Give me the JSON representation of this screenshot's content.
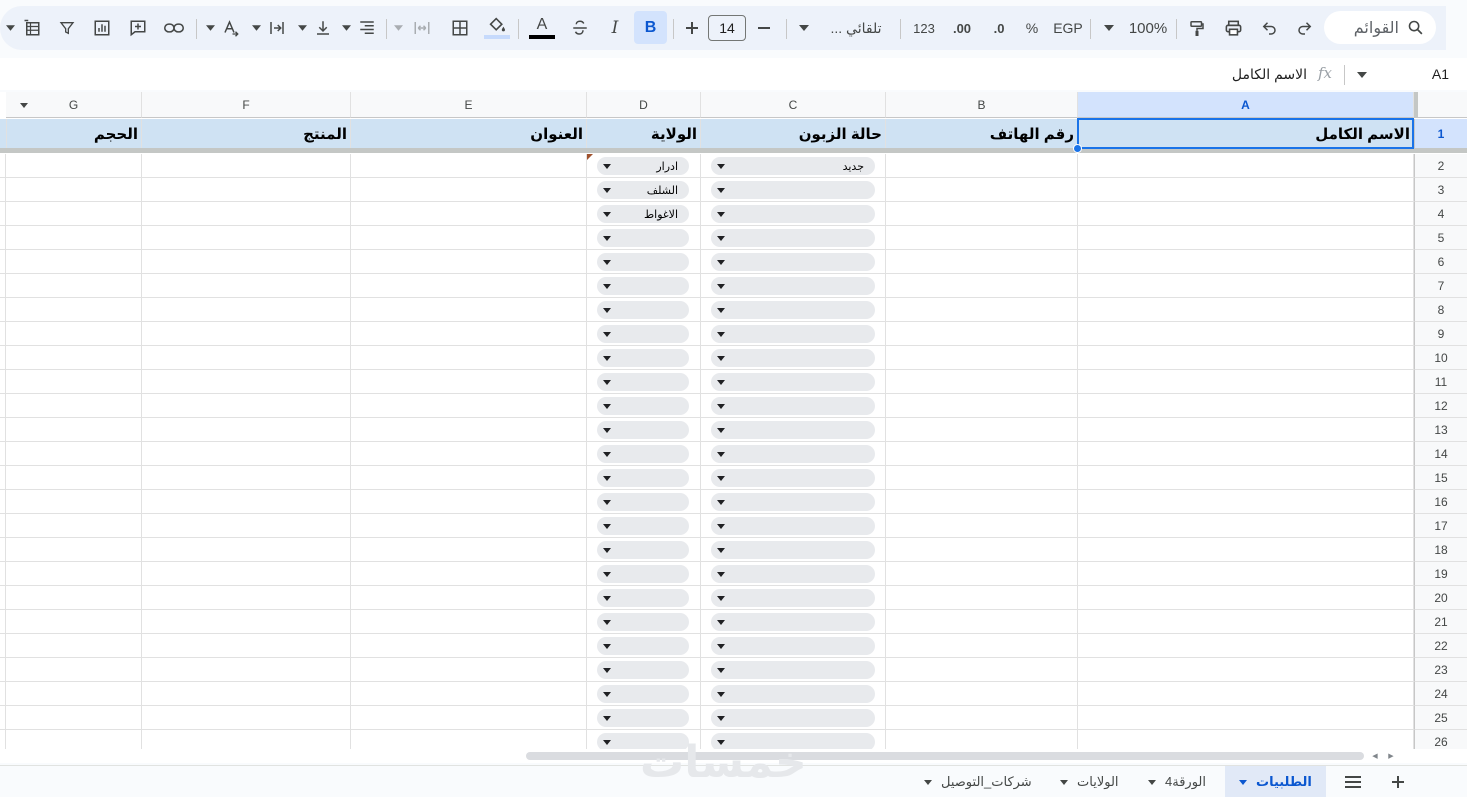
{
  "toolbar": {
    "search_label": "القوائم",
    "zoom": "100%",
    "currency": "EGP",
    "percent": "%",
    "decimal_decrease": ".0",
    "decimal_increase": ".00",
    "number_format": "123",
    "font_name": "تلقائي ...",
    "font_size": "14",
    "bold": "B",
    "italic": "I",
    "text_color_glyph": "A",
    "text_color": "#000000",
    "accent": "#0b57d0"
  },
  "formula_bar": {
    "cell_ref": "A1",
    "fx": "fx",
    "value": "الاسم الكامل"
  },
  "columns": [
    "A",
    "B",
    "C",
    "D",
    "E",
    "F",
    "G"
  ],
  "header_row": {
    "A": "الاسم الكامل",
    "B": "رقم الهاتف",
    "C": "حالة الزبون",
    "D": "الولاية",
    "E": "العنوان",
    "F": "المنتج",
    "G": "الحجم"
  },
  "row_numbers": [
    "1",
    "2",
    "3",
    "4",
    "5",
    "6",
    "7",
    "8",
    "9",
    "10",
    "11",
    "12",
    "13",
    "14",
    "15",
    "16",
    "17",
    "18",
    "19",
    "20",
    "21",
    "22",
    "23",
    "24",
    "25",
    "26"
  ],
  "dropdowns": {
    "C": [
      "جديد",
      "",
      "",
      "",
      "",
      "",
      "",
      "",
      "",
      "",
      "",
      "",
      "",
      "",
      "",
      "",
      "",
      "",
      "",
      "",
      "",
      "",
      "",
      "",
      ""
    ],
    "D": [
      "ادرار",
      "الشلف",
      "الاغواط",
      "",
      "",
      "",
      "",
      "",
      "",
      "",
      "",
      "",
      "",
      "",
      "",
      "",
      "",
      "",
      "",
      "",
      "",
      "",
      "",
      "",
      ""
    ]
  },
  "sheet_tabs": [
    {
      "label": "الطلبيات",
      "active": true
    },
    {
      "label": "الورقة4",
      "active": false
    },
    {
      "label": "الولايات",
      "active": false
    },
    {
      "label": "شركات_التوصيل",
      "active": false
    }
  ],
  "watermark": "خمسات"
}
